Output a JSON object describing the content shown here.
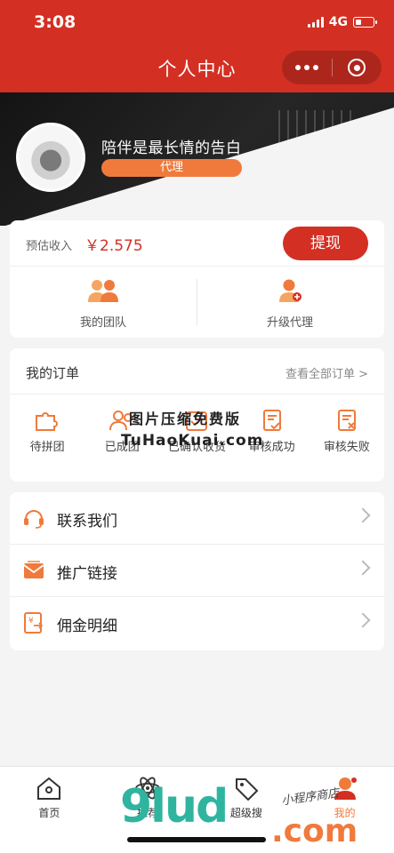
{
  "status_bar": {
    "time": "3:08",
    "network": "4G",
    "battery_level": 0.35
  },
  "header": {
    "title": "个人中心"
  },
  "profile": {
    "nickname": "陪伴是最长情的告白",
    "role": "代理"
  },
  "income": {
    "label": "预估收入",
    "value": "￥2.575",
    "withdraw_label": "提现"
  },
  "shortcuts": [
    {
      "label": "我的团队",
      "icon": "team-icon"
    },
    {
      "label": "升级代理",
      "icon": "agent-upgrade-icon"
    }
  ],
  "orders": {
    "title": "我的订单",
    "view_all": "查看全部订单 >",
    "items": [
      {
        "label": "待拼团",
        "icon": "puzzle-icon"
      },
      {
        "label": "已成团",
        "icon": "group-icon"
      },
      {
        "label": "已确认收货",
        "icon": "received-icon"
      },
      {
        "label": "审核成功",
        "icon": "audit-success-icon"
      },
      {
        "label": "审核失败",
        "icon": "audit-fail-icon"
      }
    ]
  },
  "menu": [
    {
      "label": "联系我们",
      "icon": "headset-icon"
    },
    {
      "label": "推广链接",
      "icon": "share-link-icon"
    },
    {
      "label": "佣金明细",
      "icon": "commission-icon"
    }
  ],
  "tabbar": [
    {
      "label": "首页",
      "icon": "home-icon"
    },
    {
      "label": "推荐",
      "icon": "atom-icon"
    },
    {
      "label": "超级搜",
      "icon": "tag-icon"
    },
    {
      "label": "我的",
      "icon": "profile-icon"
    }
  ],
  "watermarks": {
    "line1": "图片压缩免费版",
    "line2": "TuHaoKuai.com",
    "brand": "9lud",
    "brand_suffix": ".com",
    "brand_tagline": "小程序商店"
  },
  "colors": {
    "primary": "#d42f23",
    "accent": "#f07a3c"
  }
}
